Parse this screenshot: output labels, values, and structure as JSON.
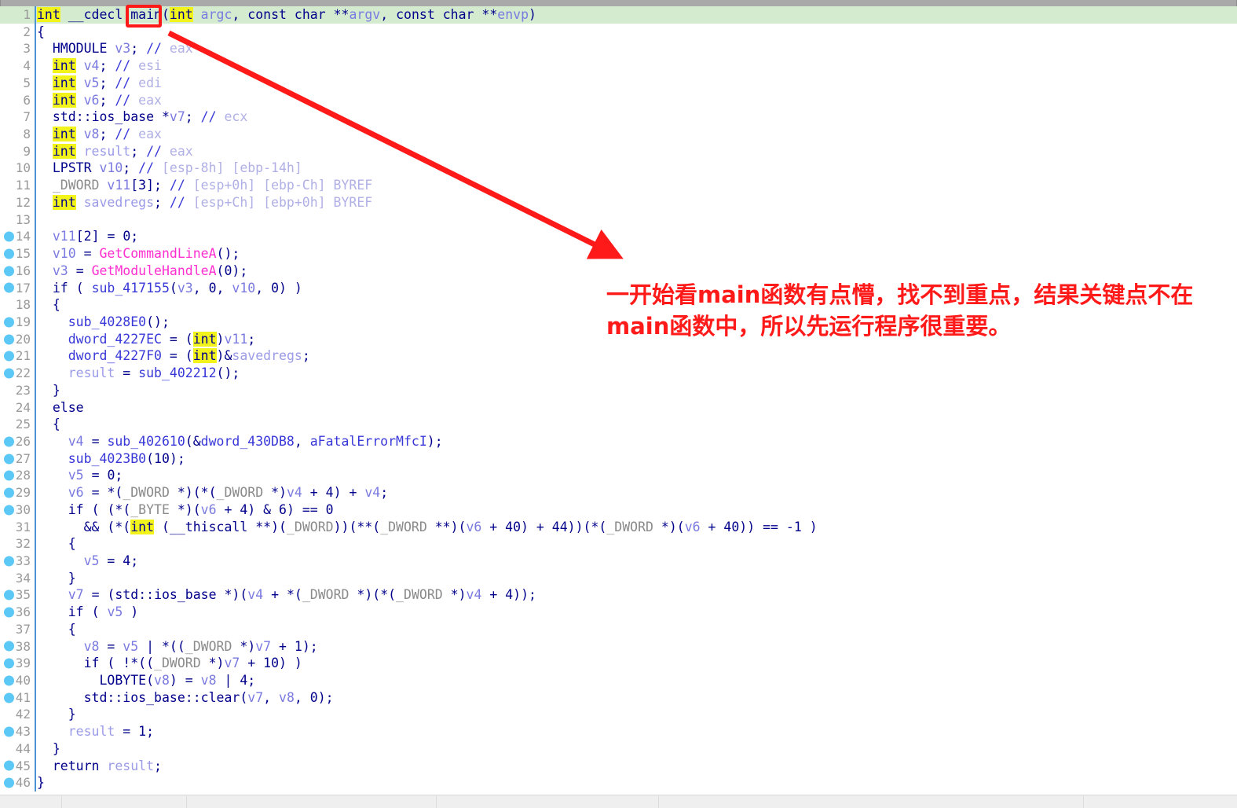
{
  "app": {
    "name": "IDA Pro Hex-Rays Decompiler Pseudocode View",
    "accent_blue": "#00008b",
    "current_line_bg": "#d4ebd0",
    "keyword_highlight_bg": "#f3f31c",
    "breakpoint_dot_color": "#5bc8f5",
    "annotation_color": "#ff1a1a",
    "gutter_separator_color": "#4c93d6"
  },
  "annotation": {
    "box_target": "main",
    "note_text": "一开始看main函数有点懵，找不到重点，结果关键点不在main函数中，所以先运行程序很重要。",
    "arrow_from": "(215, 42)",
    "arrow_to": "(785, 325)"
  },
  "code": {
    "language": "C pseudocode",
    "function_name": "main",
    "first_line_is_current": true,
    "lines": [
      {
        "n": "1",
        "dot": false,
        "cur": true,
        "text": "int __cdecl main(int argc, const char **argv, const char **envp)"
      },
      {
        "n": "2",
        "dot": false,
        "cur": false,
        "text": "{"
      },
      {
        "n": "3",
        "dot": false,
        "cur": false,
        "text": "  HMODULE v3; // eax"
      },
      {
        "n": "4",
        "dot": false,
        "cur": false,
        "text": "  int v4; // esi"
      },
      {
        "n": "5",
        "dot": false,
        "cur": false,
        "text": "  int v5; // edi"
      },
      {
        "n": "6",
        "dot": false,
        "cur": false,
        "text": "  int v6; // eax"
      },
      {
        "n": "7",
        "dot": false,
        "cur": false,
        "text": "  std::ios_base *v7; // ecx"
      },
      {
        "n": "8",
        "dot": false,
        "cur": false,
        "text": "  int v8; // eax"
      },
      {
        "n": "9",
        "dot": false,
        "cur": false,
        "text": "  int result; // eax"
      },
      {
        "n": "10",
        "dot": false,
        "cur": false,
        "text": "  LPSTR v10; // [esp-8h] [ebp-14h]"
      },
      {
        "n": "11",
        "dot": false,
        "cur": false,
        "text": "  _DWORD v11[3]; // [esp+0h] [ebp-Ch] BYREF"
      },
      {
        "n": "12",
        "dot": false,
        "cur": false,
        "text": "  int savedregs; // [esp+Ch] [ebp+0h] BYREF"
      },
      {
        "n": "13",
        "dot": false,
        "cur": false,
        "text": ""
      },
      {
        "n": "14",
        "dot": true,
        "cur": false,
        "text": "  v11[2] = 0;"
      },
      {
        "n": "15",
        "dot": true,
        "cur": false,
        "text": "  v10 = GetCommandLineA();"
      },
      {
        "n": "16",
        "dot": true,
        "cur": false,
        "text": "  v3 = GetModuleHandleA(0);"
      },
      {
        "n": "17",
        "dot": true,
        "cur": false,
        "text": "  if ( sub_417155(v3, 0, v10, 0) )"
      },
      {
        "n": "18",
        "dot": false,
        "cur": false,
        "text": "  {"
      },
      {
        "n": "19",
        "dot": true,
        "cur": false,
        "text": "    sub_4028E0();"
      },
      {
        "n": "20",
        "dot": true,
        "cur": false,
        "text": "    dword_4227EC = (int)v11;"
      },
      {
        "n": "21",
        "dot": true,
        "cur": false,
        "text": "    dword_4227F0 = (int)&savedregs;"
      },
      {
        "n": "22",
        "dot": true,
        "cur": false,
        "text": "    result = sub_402212();"
      },
      {
        "n": "23",
        "dot": false,
        "cur": false,
        "text": "  }"
      },
      {
        "n": "24",
        "dot": false,
        "cur": false,
        "text": "  else"
      },
      {
        "n": "25",
        "dot": false,
        "cur": false,
        "text": "  {"
      },
      {
        "n": "26",
        "dot": true,
        "cur": false,
        "text": "    v4 = sub_402610(&dword_430DB8, aFatalErrorMfcI);"
      },
      {
        "n": "27",
        "dot": true,
        "cur": false,
        "text": "    sub_4023B0(10);"
      },
      {
        "n": "28",
        "dot": true,
        "cur": false,
        "text": "    v5 = 0;"
      },
      {
        "n": "29",
        "dot": true,
        "cur": false,
        "text": "    v6 = *(_DWORD *)(*(_DWORD *)v4 + 4) + v4;"
      },
      {
        "n": "30",
        "dot": true,
        "cur": false,
        "text": "    if ( (*(_BYTE *)(v6 + 4) & 6) == 0"
      },
      {
        "n": "31",
        "dot": false,
        "cur": false,
        "text": "      && (*(int (__thiscall **)(_DWORD))(**(_DWORD **)(v6 + 40) + 44))(*(_DWORD *)(v6 + 40)) == -1 )"
      },
      {
        "n": "32",
        "dot": false,
        "cur": false,
        "text": "    {"
      },
      {
        "n": "33",
        "dot": true,
        "cur": false,
        "text": "      v5 = 4;"
      },
      {
        "n": "34",
        "dot": false,
        "cur": false,
        "text": "    }"
      },
      {
        "n": "35",
        "dot": true,
        "cur": false,
        "text": "    v7 = (std::ios_base *)(v4 + *(_DWORD *)(*(_DWORD *)v4 + 4));"
      },
      {
        "n": "36",
        "dot": true,
        "cur": false,
        "text": "    if ( v5 )"
      },
      {
        "n": "37",
        "dot": false,
        "cur": false,
        "text": "    {"
      },
      {
        "n": "38",
        "dot": true,
        "cur": false,
        "text": "      v8 = v5 | *((_DWORD *)v7 + 1);"
      },
      {
        "n": "39",
        "dot": true,
        "cur": false,
        "text": "      if ( !*((_DWORD *)v7 + 10) )"
      },
      {
        "n": "40",
        "dot": true,
        "cur": false,
        "text": "        LOBYTE(v8) = v8 | 4;"
      },
      {
        "n": "41",
        "dot": true,
        "cur": false,
        "text": "      std::ios_base::clear(v7, v8, 0);"
      },
      {
        "n": "42",
        "dot": false,
        "cur": false,
        "text": "    }"
      },
      {
        "n": "43",
        "dot": true,
        "cur": false,
        "text": "    result = 1;"
      },
      {
        "n": "44",
        "dot": false,
        "cur": false,
        "text": "  }"
      },
      {
        "n": "45",
        "dot": true,
        "cur": false,
        "text": "  return result;"
      },
      {
        "n": "46",
        "dot": true,
        "cur": false,
        "text": "}"
      }
    ]
  },
  "tokens": {
    "highlighted_keyword": "int",
    "api_calls": [
      "GetCommandLineA",
      "GetModuleHandleA"
    ],
    "sub_calls": [
      "sub_417155",
      "sub_4028E0",
      "sub_402212",
      "sub_402610",
      "sub_4023B0"
    ],
    "globals": [
      "dword_4227EC",
      "dword_4227F0",
      "dword_430DB8",
      "aFatalErrorMfcI"
    ],
    "locals": [
      "v3",
      "v4",
      "v5",
      "v6",
      "v7",
      "v8",
      "v10",
      "v11",
      "result",
      "savedregs",
      "argc",
      "argv",
      "envp"
    ]
  }
}
